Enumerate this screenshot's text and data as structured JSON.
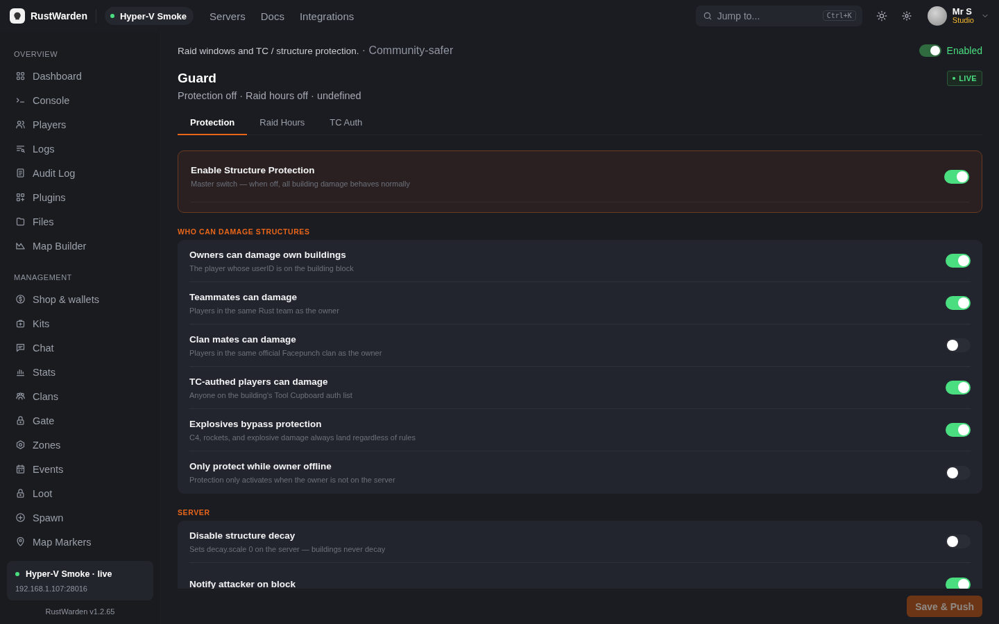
{
  "app": {
    "name": "RustWarden"
  },
  "server_pill": {
    "label": "Hyper-V Smoke",
    "live": true
  },
  "nav": [
    "Servers",
    "Docs",
    "Integrations"
  ],
  "search": {
    "placeholder": "Jump to...",
    "shortcut": "Ctrl+K"
  },
  "user": {
    "name": "Mr S",
    "plan": "Studio"
  },
  "sidebar": {
    "sections": [
      {
        "title": "OVERVIEW",
        "items": [
          {
            "label": "Dashboard",
            "selected": false
          },
          {
            "label": "Console",
            "selected": false
          },
          {
            "label": "Players",
            "selected": false
          },
          {
            "label": "Logs",
            "selected": false
          },
          {
            "label": "Audit Log",
            "selected": false
          },
          {
            "label": "Plugins",
            "selected": false
          },
          {
            "label": "Files",
            "selected": false
          },
          {
            "label": "Map Builder",
            "selected": false
          }
        ]
      },
      {
        "title": "MANAGEMENT",
        "items": [
          {
            "label": "Shop & wallets",
            "selected": false
          },
          {
            "label": "Kits",
            "selected": false
          },
          {
            "label": "Chat",
            "selected": false
          },
          {
            "label": "Stats",
            "selected": false
          },
          {
            "label": "Clans",
            "selected": false
          },
          {
            "label": "Gate",
            "selected": false
          },
          {
            "label": "Zones",
            "selected": false
          },
          {
            "label": "Events",
            "selected": false
          },
          {
            "label": "Loot",
            "selected": false
          },
          {
            "label": "Spawn",
            "selected": false
          },
          {
            "label": "Map Markers",
            "selected": false
          }
        ]
      }
    ],
    "server_card": {
      "title": "Hyper-V Smoke · live",
      "address": "192.168.1.107:28016",
      "live": true
    },
    "version": "RustWarden v1.2.65"
  },
  "page": {
    "description": "Raid windows and TC / structure protection.",
    "tag": "· Community-safer",
    "enabled": {
      "label": "Enabled",
      "on": true
    },
    "title": "Guard",
    "badge": "LIVE",
    "subtitle": "Protection off · Raid hours off · undefined",
    "tabs": [
      {
        "label": "Protection",
        "selected": true
      },
      {
        "label": "Raid Hours",
        "selected": false
      },
      {
        "label": "TC Auth",
        "selected": false
      }
    ],
    "master": {
      "title": "Enable Structure Protection",
      "description": "Master switch — when off, all building damage behaves normally",
      "on": true
    },
    "sections": [
      {
        "title": "WHO CAN DAMAGE STRUCTURES",
        "rows": [
          {
            "title": "Owners can damage own buildings",
            "description": "The player whose userID is on the building block",
            "on": true
          },
          {
            "title": "Teammates can damage",
            "description": "Players in the same Rust team as the owner",
            "on": true
          },
          {
            "title": "Clan mates can damage",
            "description": "Players in the same official Facepunch clan as the owner",
            "on": false
          },
          {
            "title": "TC-authed players can damage",
            "description": "Anyone on the building's Tool Cupboard auth list",
            "on": true
          },
          {
            "title": "Explosives bypass protection",
            "description": "C4, rockets, and explosive damage always land regardless of rules",
            "on": true
          },
          {
            "title": "Only protect while owner offline",
            "description": "Protection only activates when the owner is not on the server",
            "on": false
          }
        ]
      },
      {
        "title": "SERVER",
        "rows": [
          {
            "title": "Disable structure decay",
            "description": "Sets decay.scale 0 on the server — buildings never decay",
            "on": false
          },
          {
            "title": "Notify attacker on block",
            "on": true
          }
        ]
      }
    ],
    "save": {
      "label": "Save & Push",
      "disabled": true
    }
  }
}
